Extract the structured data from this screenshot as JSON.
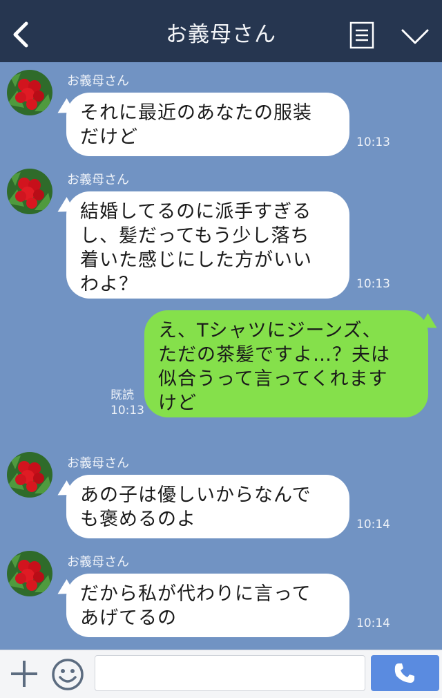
{
  "header": {
    "title": "お義母さん",
    "icons": [
      "back-icon",
      "menu-icon",
      "chevron-down-icon"
    ]
  },
  "messages": [
    {
      "sender": "お義母さん",
      "text": "それに最近のあなたの服装\nだけど",
      "time": "10:13"
    },
    {
      "sender": "お義母さん",
      "text": "結婚してるのに派手すぎる\nし、髪だってもう少し落ち\n着いた感じにした方がいい\nわよ？",
      "time": "10:13"
    },
    {
      "sender": "me",
      "text": "え、Tシャツにジーンズ、\nただの茶髪ですよ…？夫は\n似合うって言ってくれます\nけど",
      "read": "既読",
      "time": "10:13"
    },
    {
      "sender": "お義母さん",
      "text": "あの子は優しいからなんで\nも褒めるのよ",
      "time": "10:14"
    },
    {
      "sender": "お義母さん",
      "text": "だから私が代わりに言って\nあげてるの",
      "time": "10:14"
    }
  ],
  "inputbar": {
    "placeholder": "",
    "icons": [
      "plus-icon",
      "smile-icon",
      "phone-icon"
    ]
  },
  "colors": {
    "background": "#7193c3",
    "header": "#263650",
    "incoming_bubble": "#ffffff",
    "outgoing_bubble": "#85e04b",
    "call_button": "#5a8be0"
  }
}
